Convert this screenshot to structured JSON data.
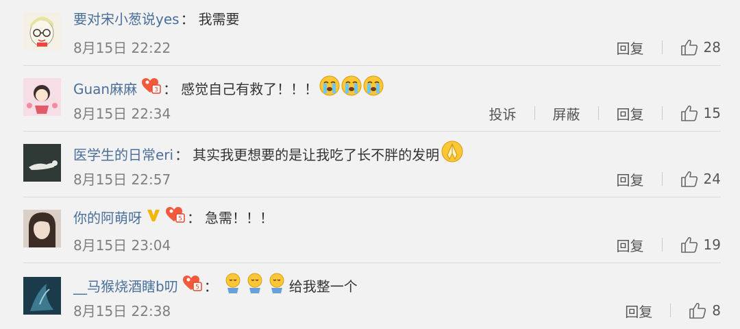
{
  "comments": [
    {
      "user": "要对宋小葱说yes",
      "text": "我需要",
      "time": "8月15日 22:22",
      "actions": [
        "回复"
      ],
      "likes": "28"
    },
    {
      "user": "Guan麻麻",
      "text": "感觉自己有救了！！！",
      "time": "8月15日 22:34",
      "actions": [
        "投诉",
        "屏蔽",
        "回复"
      ],
      "likes": "15"
    },
    {
      "user": "医学生的日常eri",
      "text": "其实我更想要的是让我吃了长不胖的发明",
      "time": "8月15日 22:57",
      "actions": [
        "回复"
      ],
      "likes": "24"
    },
    {
      "user": "你的阿萌呀",
      "text": "急需！！！",
      "time": "8月15日 23:04",
      "actions": [
        "回复"
      ],
      "likes": "19"
    },
    {
      "user": "__马猴烧酒瞎b叨",
      "text": "给我整一个",
      "time": "8月15日 22:38",
      "actions": [
        "回复"
      ],
      "likes": "8"
    }
  ],
  "icons": {
    "like": "thumbs-up-icon",
    "member_badge": "heart-member-badge-icon",
    "verified": "yellow-v-icon",
    "emoji_crying": "crying-face-icon",
    "emoji_pray": "pray-hands-icon",
    "emoji_doll": "sad-doll-icon"
  },
  "colors": {
    "background": "#f2f2f2",
    "username": "#4a6f9b",
    "meta": "#7f7f7f",
    "divider": "#d9d9d9"
  }
}
